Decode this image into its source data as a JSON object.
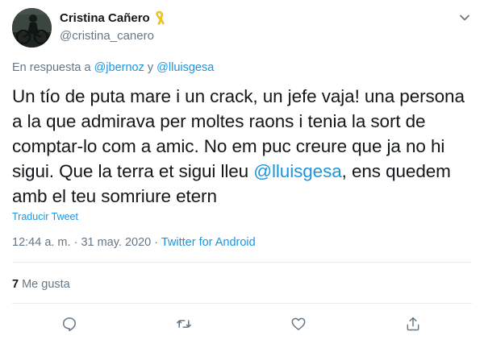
{
  "author": {
    "name": "Cristina Cañero",
    "handle": "@cristina_canero",
    "badge_icon": "yellow-ribbon-icon"
  },
  "reply": {
    "prefix": "En respuesta a ",
    "mention1": "@jbernoz",
    "joiner": " y ",
    "mention2": "@lluisgesa"
  },
  "tweet": {
    "text_before": "Un tío de puta mare i un crack, un jefe vaja! una persona a la que admirava per moltes raons i tenia la sort de comptar-lo com a amic. No em puc creure que ja no hi sigui. Que la terra et sigui lleu ",
    "mention": "@lluisgesa",
    "text_after": ", ens quedem amb el teu somriure etern"
  },
  "translate_label": "Traducir Tweet",
  "meta": {
    "time": "12:44 a. m.",
    "sep1": " · ",
    "date": "31 may. 2020",
    "sep2": " · ",
    "source": "Twitter for Android"
  },
  "stats": {
    "likes_count": "7",
    "likes_label": " Me gusta"
  },
  "colors": {
    "accent": "#1b95e0",
    "secondary_text": "#657786",
    "primary_text": "#14171a",
    "divider": "#e6ecf0"
  },
  "action_icons": [
    "reply-icon",
    "retweet-icon",
    "like-icon",
    "share-icon"
  ]
}
